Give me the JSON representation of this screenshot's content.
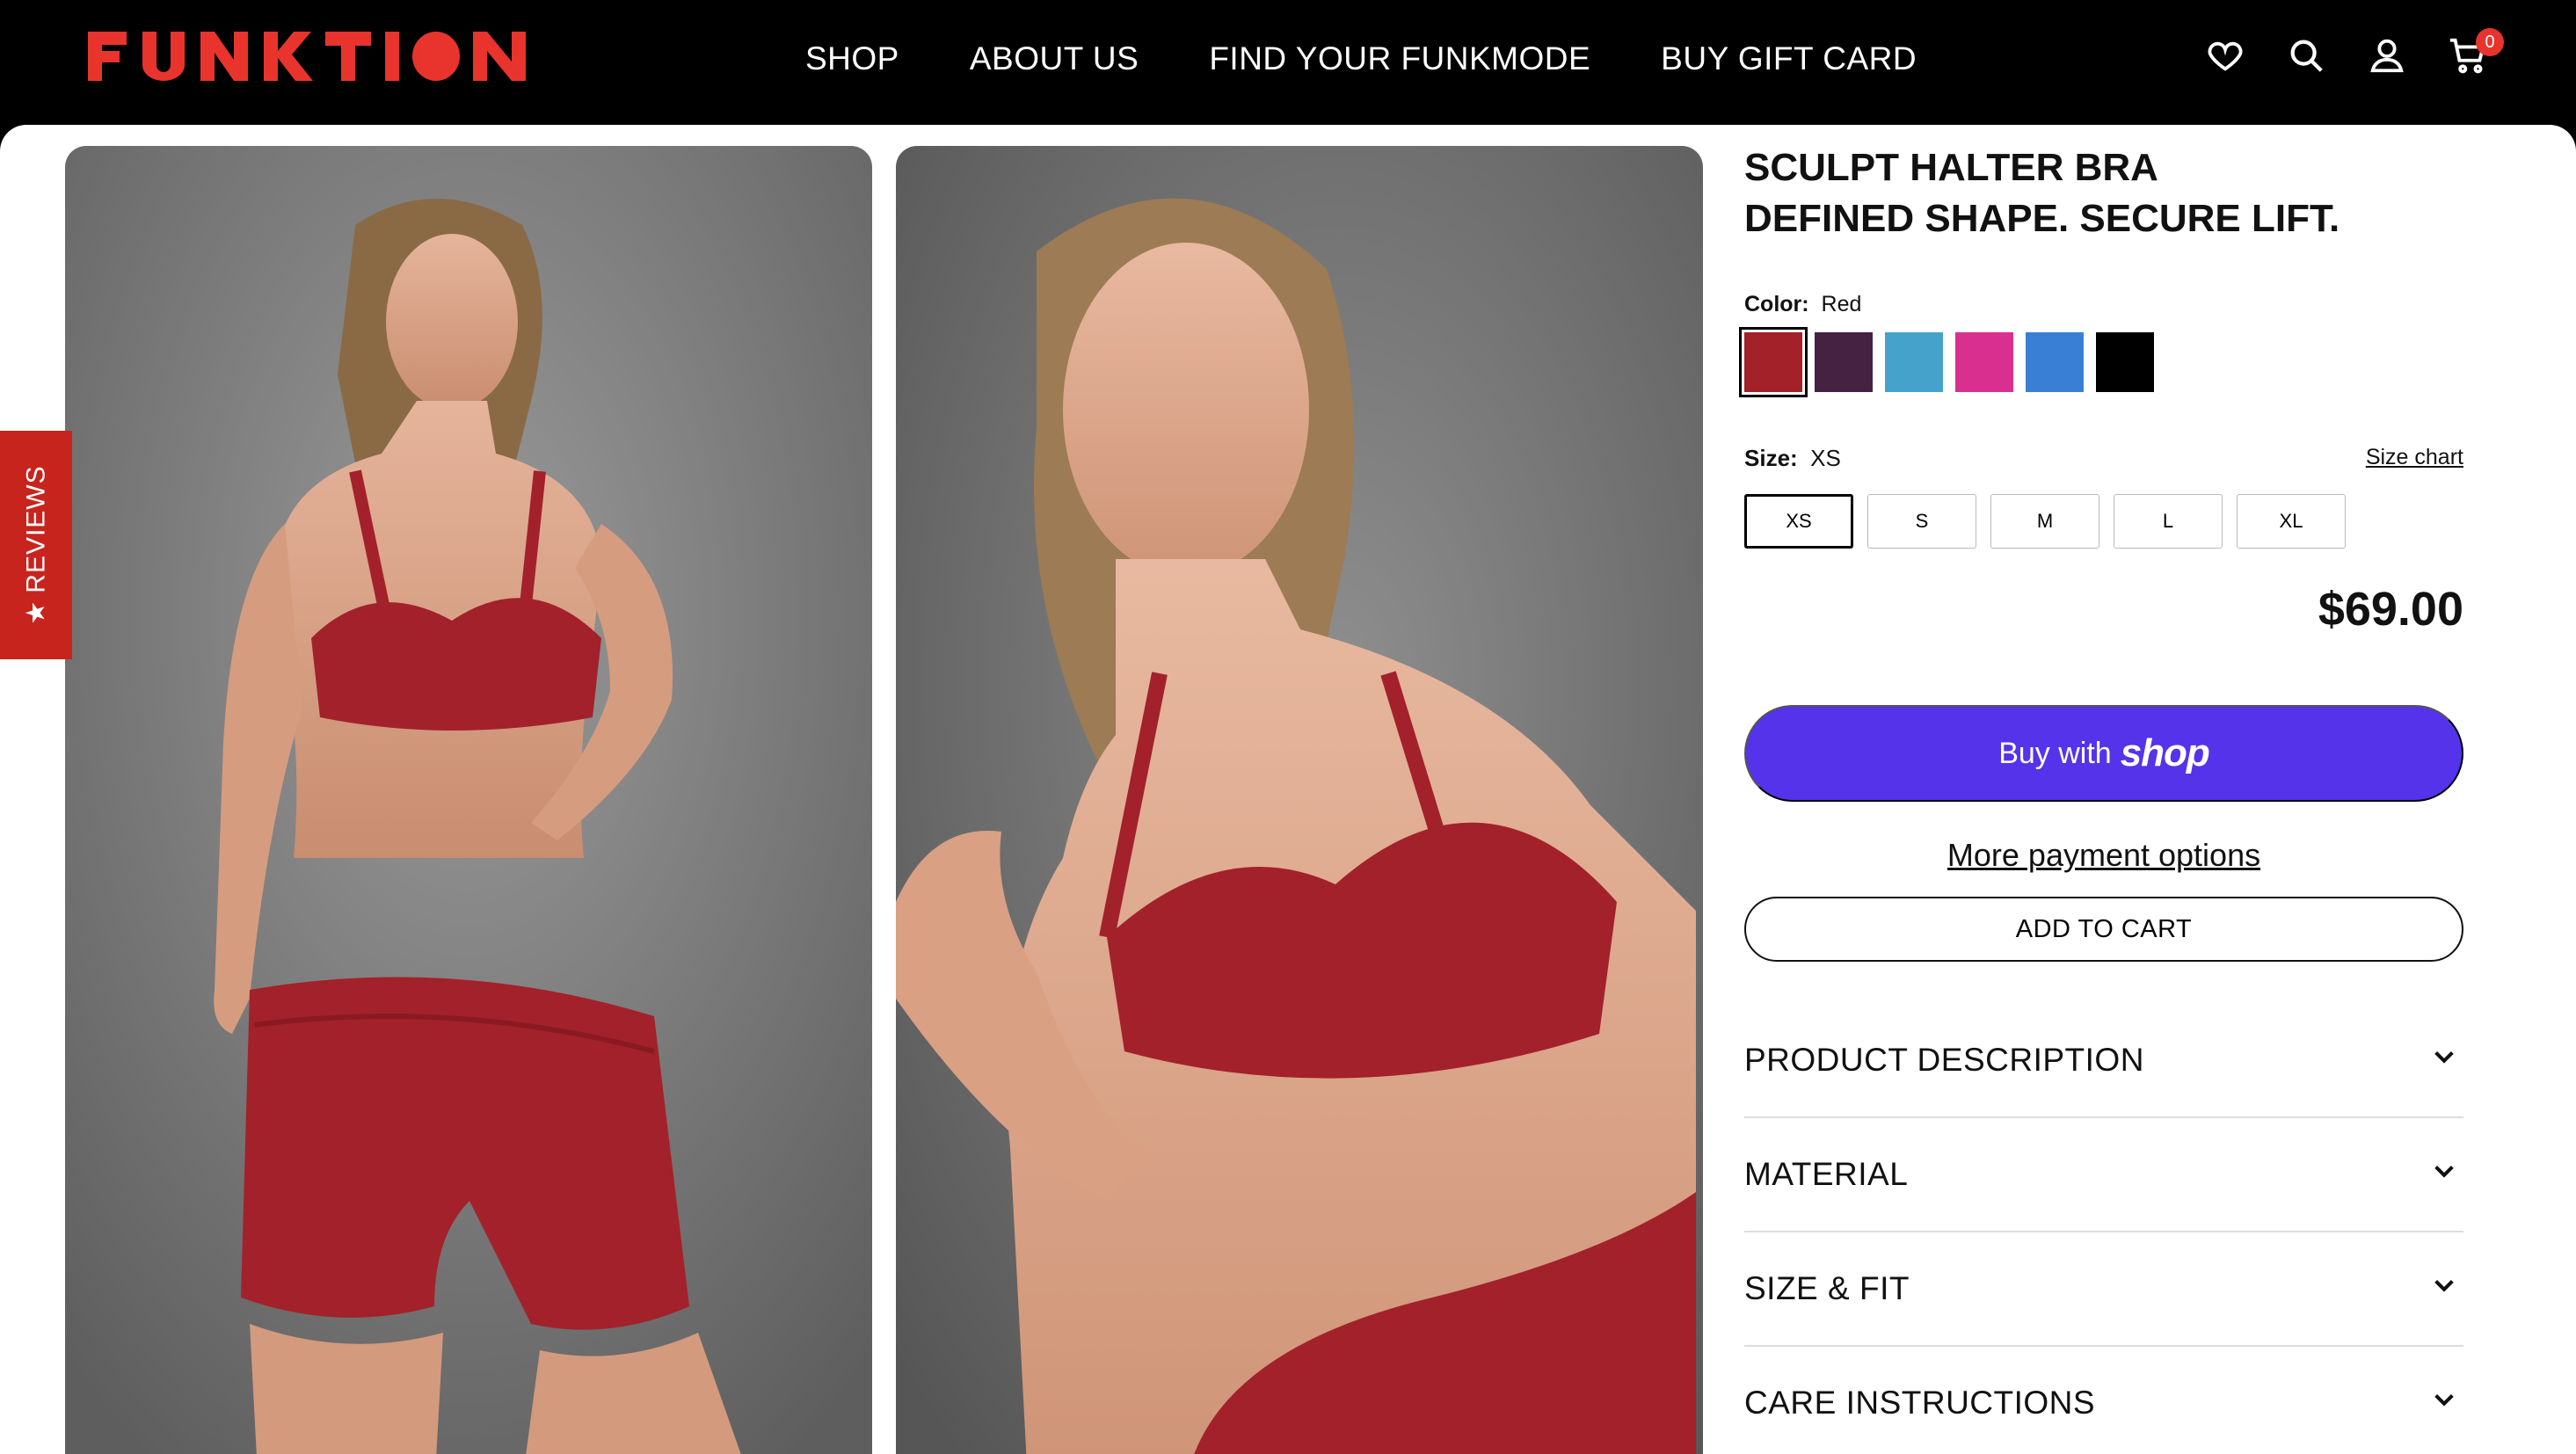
{
  "brand": {
    "name": "FUNKTION",
    "color": "#e8342c"
  },
  "nav": [
    "SHOP",
    "ABOUT US",
    "FIND YOUR FUNKMODE",
    "BUY GIFT CARD"
  ],
  "header_icons": {
    "wishlist": "heart-icon",
    "search": "search-icon",
    "account": "user-icon",
    "cart": "cart-icon",
    "cart_count": "0"
  },
  "reviews_tab": {
    "label": "REVIEWS",
    "star": "★"
  },
  "product": {
    "title_line1": "SCULPT HALTER BRA",
    "title_line2": "DEFINED SHAPE. SECURE LIFT.",
    "color_label": "Color:",
    "color_value": "Red",
    "swatches": [
      {
        "name": "Red",
        "hex": "#a32128",
        "selected": true
      },
      {
        "name": "Plum",
        "hex": "#452142"
      },
      {
        "name": "Sky Blue",
        "hex": "#45a2cb"
      },
      {
        "name": "Pink",
        "hex": "#d9308f"
      },
      {
        "name": "Blue",
        "hex": "#3a7fd6"
      },
      {
        "name": "Black",
        "hex": "#000000"
      }
    ],
    "size_label": "Size:",
    "size_value": "XS",
    "size_chart": "Size chart",
    "sizes": [
      "XS",
      "S",
      "M",
      "L",
      "XL"
    ],
    "price": "$69.00",
    "buy_with": "Buy with",
    "shop_word": "shop",
    "more_payment": "More payment options",
    "add_to_cart": "ADD TO CART",
    "accordions": [
      "PRODUCT DESCRIPTION",
      "MATERIAL",
      "SIZE & FIT",
      "CARE INSTRUCTIONS"
    ]
  },
  "colors": {
    "shop_pay": "#5433eb",
    "reviews_tab": "#c8241e"
  }
}
